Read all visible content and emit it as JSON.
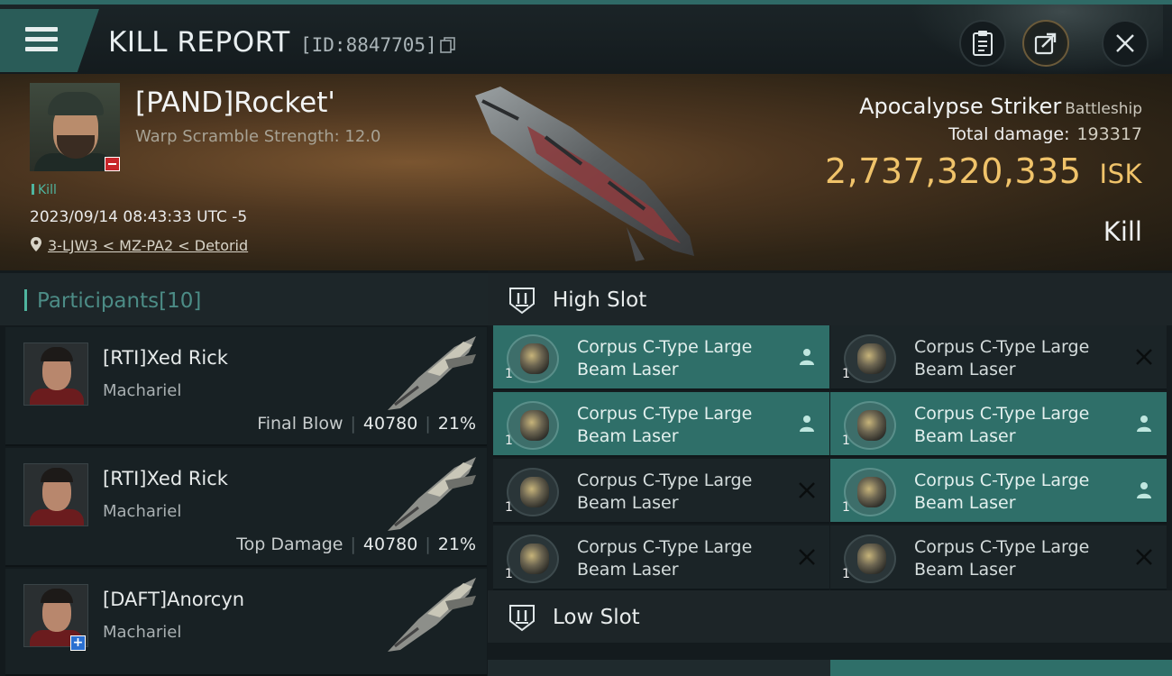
{
  "header": {
    "title": "KILL REPORT",
    "report_id": "[ID:8847705]",
    "icons": [
      "menu-icon",
      "copy-icon",
      "clipboard-icon",
      "share-icon",
      "close-icon"
    ]
  },
  "victim": {
    "name": "[PAND]Rocket'",
    "warp_scramble": "Warp Scramble Strength: 12.0",
    "tag": "Kill",
    "datetime": "2023/09/14 08:43:33 UTC -5",
    "location": "3-LJW3 < MZ-PA2 < Detorid",
    "ship_name": "Apocalypse Striker",
    "ship_class": "Battleship",
    "total_damage_label": "Total damage:",
    "total_damage": "193317",
    "isk_value": "2,737,320,335",
    "isk_unit": "ISK",
    "result": "Kill"
  },
  "participants": {
    "label": "Participants",
    "count": "[10]",
    "rows": [
      {
        "name": "[RTI]Xed Rick",
        "ship": "Machariel",
        "role": "Final Blow",
        "damage": "40780",
        "percent": "21%"
      },
      {
        "name": "[RTI]Xed Rick",
        "ship": "Machariel",
        "role": "Top Damage",
        "damage": "40780",
        "percent": "21%"
      },
      {
        "name": "[DAFT]Anorcyn",
        "ship": "Machariel",
        "role": "",
        "damage": "",
        "percent": ""
      }
    ]
  },
  "slots": {
    "high_label": "High Slot",
    "low_label": "Low Slot",
    "high_modules": [
      {
        "name": "Corpus C-Type Large Beam Laser",
        "qty": "1",
        "state": "dropped"
      },
      {
        "name": "Corpus C-Type Large Beam Laser",
        "qty": "1",
        "state": "destroyed"
      },
      {
        "name": "Corpus C-Type Large Beam Laser",
        "qty": "1",
        "state": "dropped"
      },
      {
        "name": "Corpus C-Type Large Beam Laser",
        "qty": "1",
        "state": "dropped"
      },
      {
        "name": "Corpus C-Type Large Beam Laser",
        "qty": "1",
        "state": "destroyed"
      },
      {
        "name": "Corpus C-Type Large Beam Laser",
        "qty": "1",
        "state": "dropped"
      },
      {
        "name": "Corpus C-Type Large Beam Laser",
        "qty": "1",
        "state": "destroyed"
      },
      {
        "name": "Corpus C-Type Large Beam Laser",
        "qty": "1",
        "state": "destroyed"
      }
    ]
  },
  "colors": {
    "accent": "#4fb59f",
    "dropped": "#2f6f69",
    "isk": "#f0c36a",
    "badge_red": "#c8262b",
    "badge_blue": "#2a6fd0"
  }
}
